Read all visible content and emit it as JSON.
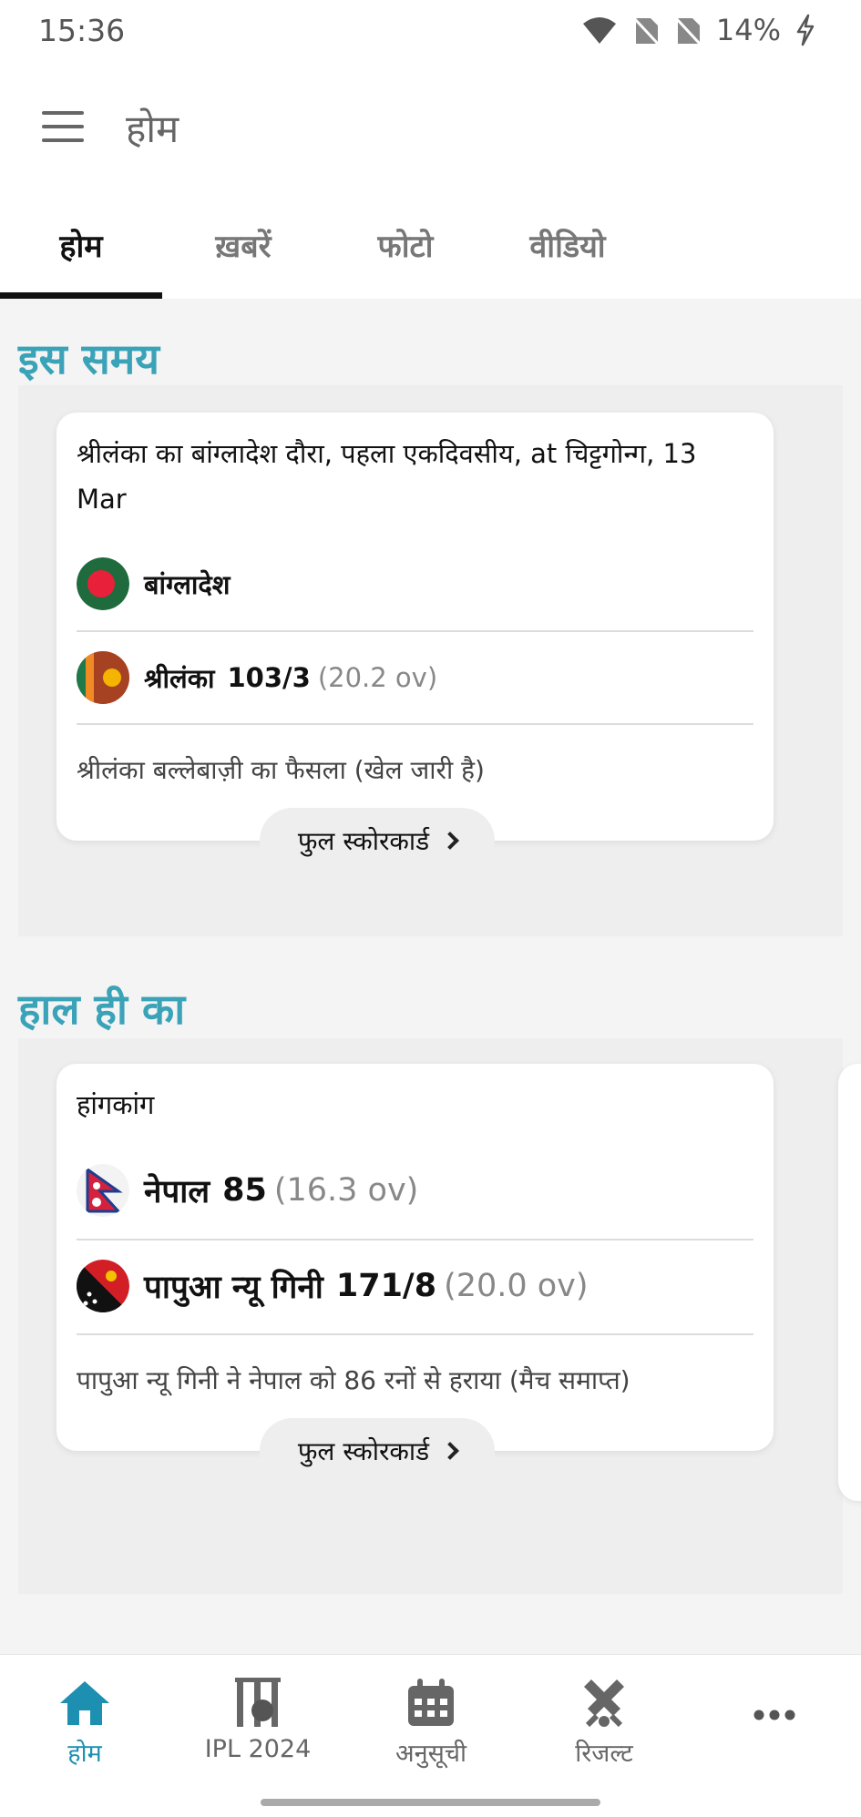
{
  "status_bar": {
    "time": "15:36",
    "battery": "14%"
  },
  "app_bar": {
    "title": "होम"
  },
  "tabs": [
    {
      "label": "होम",
      "active": true
    },
    {
      "label": "ख़बरें",
      "active": false
    },
    {
      "label": "फोटो",
      "active": false
    },
    {
      "label": "वीडियो",
      "active": false
    }
  ],
  "live_section": {
    "title": "इस समय",
    "match": {
      "heading": "श्रीलंका का बांग्लादेश दौरा, पहला एकदिवसीय, at चिट्टगोन्ग, 13 Mar",
      "team1": {
        "name": "बांग्लादेश",
        "score": "",
        "overs": ""
      },
      "team2": {
        "name": "श्रीलंका",
        "score": "103/3",
        "overs": "(20.2 ov)"
      },
      "status": "श्रीलंका बल्लेबाज़ी का फैसला (खेल जारी है)",
      "button": "फुल स्कोरकार्ड"
    }
  },
  "recent_section": {
    "title": "हाल ही का",
    "match": {
      "heading": "हांगकांग",
      "team1": {
        "name": "नेपाल",
        "score": "85",
        "overs": "(16.3 ov)"
      },
      "team2": {
        "name": "पापुआ न्यू गिनी",
        "score": "171/8",
        "overs": "(20.0 ov)"
      },
      "status": "पापुआ न्यू गिनी ने नेपाल को 86 रनों से हराया (मैच समाप्त)",
      "button": "फुल स्कोरकार्ड"
    }
  },
  "bottom_nav": [
    {
      "label": "होम",
      "icon": "home-icon",
      "active": true
    },
    {
      "label": "IPL 2024",
      "icon": "ipl-stumps-icon",
      "active": false
    },
    {
      "label": "अनुसूची",
      "icon": "calendar-icon",
      "active": false
    },
    {
      "label": "रिजल्ट",
      "icon": "cricket-bats-icon",
      "active": false
    },
    {
      "label": "",
      "icon": "more-icon",
      "active": false
    }
  ],
  "colors": {
    "accent": "#3aa3b8",
    "nav_active": "#1d8fb0"
  }
}
